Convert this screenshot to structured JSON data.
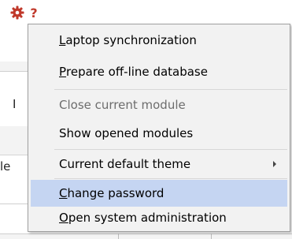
{
  "toolbar": {
    "settings_icon": "gear-icon",
    "help_label": "?",
    "accent": "#c0392b"
  },
  "background": {
    "frag_1": "I",
    "frag_2": "le"
  },
  "menu": {
    "highlight_color": "#c5d5f2",
    "items": [
      {
        "mnemonic": "L",
        "rest": "aptop synchronization",
        "enabled": true
      },
      {
        "mnemonic": "P",
        "rest": "repare off-line database",
        "enabled": true
      },
      {
        "label": "Close current module",
        "enabled": false
      },
      {
        "label": "Show opened modules",
        "enabled": true
      },
      {
        "label": "Current default theme",
        "enabled": true,
        "submenu": true
      },
      {
        "mnemonic": "C",
        "rest": "hange password",
        "enabled": true,
        "highlighted": true
      },
      {
        "mnemonic": "O",
        "rest": "pen system administration",
        "enabled": true
      }
    ]
  }
}
